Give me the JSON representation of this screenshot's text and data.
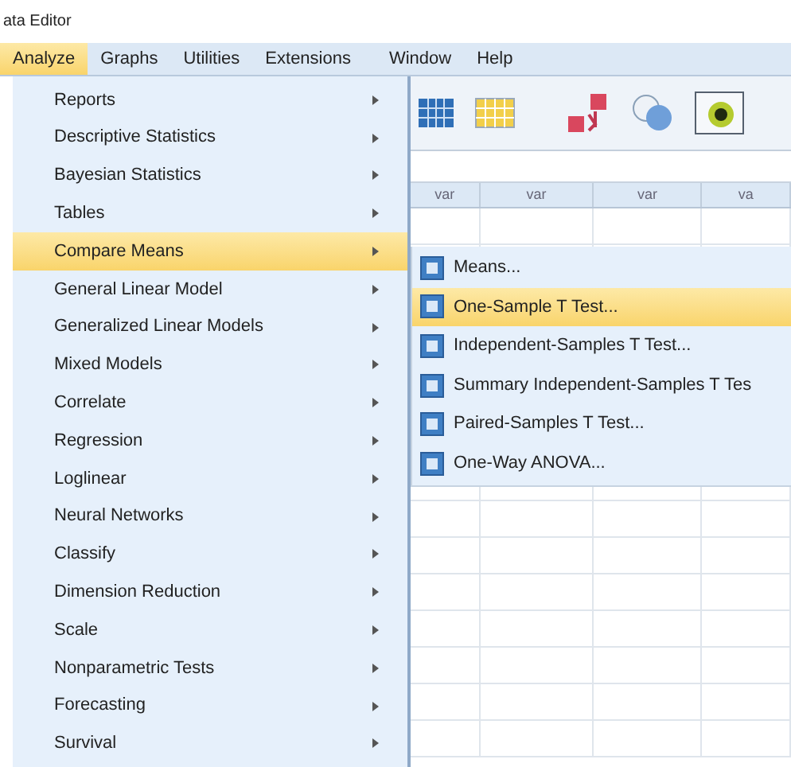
{
  "window": {
    "title": "ata Editor"
  },
  "menu_bar": [
    {
      "label": "Analyze",
      "selected": true
    },
    {
      "label": "Graphs",
      "selected": false
    },
    {
      "label": "Utilities",
      "selected": false
    },
    {
      "label": "Extensions",
      "selected": false
    },
    {
      "label": "Window",
      "selected": false
    },
    {
      "label": "Help",
      "selected": false
    }
  ],
  "grid": {
    "columns": [
      "var",
      "var",
      "var",
      "va"
    ]
  },
  "analyze_menu": [
    {
      "label": "Reports",
      "selected": false
    },
    {
      "label": "Descriptive Statistics",
      "selected": false
    },
    {
      "label": "Bayesian Statistics",
      "selected": false
    },
    {
      "label": "Tables",
      "selected": false
    },
    {
      "label": "Compare Means",
      "selected": true
    },
    {
      "label": "General Linear Model",
      "selected": false
    },
    {
      "label": "Generalized Linear Models",
      "selected": false
    },
    {
      "label": "Mixed Models",
      "selected": false
    },
    {
      "label": "Correlate",
      "selected": false
    },
    {
      "label": "Regression",
      "selected": false
    },
    {
      "label": "Loglinear",
      "selected": false
    },
    {
      "label": "Neural Networks",
      "selected": false
    },
    {
      "label": "Classify",
      "selected": false
    },
    {
      "label": "Dimension Reduction",
      "selected": false
    },
    {
      "label": "Scale",
      "selected": false
    },
    {
      "label": "Nonparametric Tests",
      "selected": false
    },
    {
      "label": "Forecasting",
      "selected": false
    },
    {
      "label": "Survival",
      "selected": false
    }
  ],
  "compare_means_submenu": [
    {
      "label": "Means...",
      "selected": false
    },
    {
      "label": "One-Sample T Test...",
      "selected": true
    },
    {
      "label": "Independent-Samples T Test...",
      "selected": false
    },
    {
      "label": "Summary Independent-Samples T Tes",
      "selected": false
    },
    {
      "label": "Paired-Samples T Test...",
      "selected": false
    },
    {
      "label": "One-Way ANOVA...",
      "selected": false
    }
  ]
}
